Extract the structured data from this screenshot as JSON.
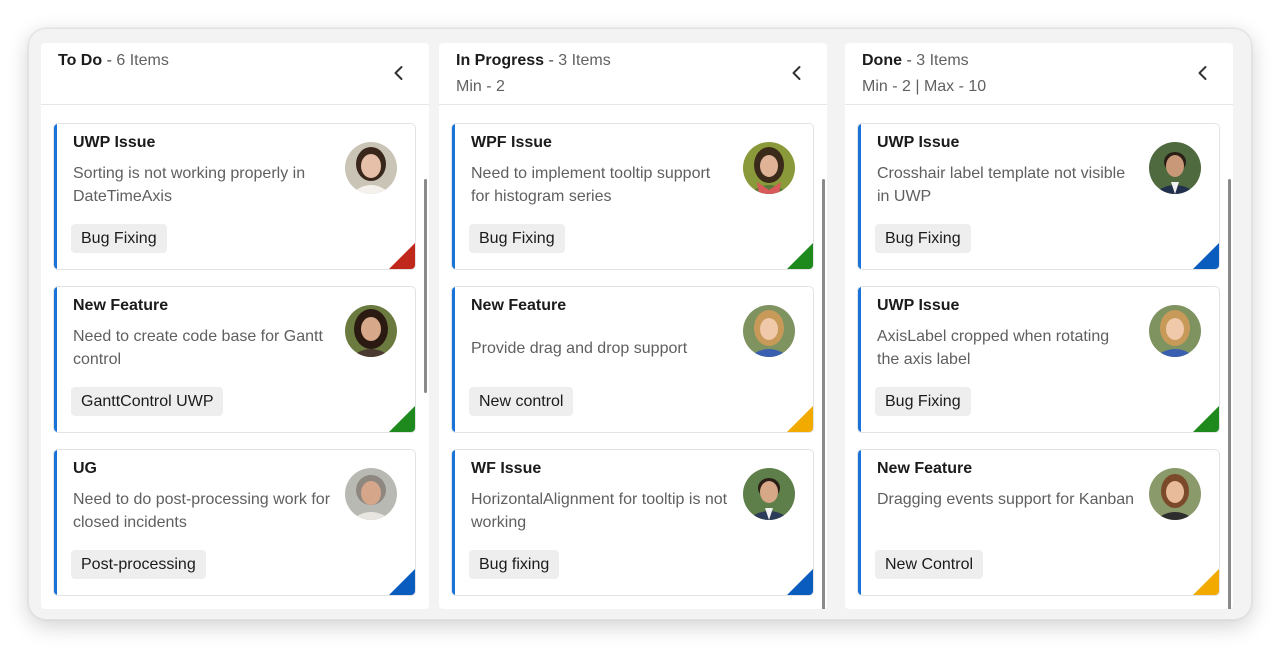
{
  "columns": [
    {
      "title": "To Do",
      "separator": " - ",
      "count": "6 Items",
      "limits": "",
      "collapse_icon": "chevron-left-icon",
      "cards": [
        {
          "title": "UWP Issue",
          "description": "Sorting is not working properly in DateTimeAxis",
          "tag": "Bug Fixing",
          "priority_color": "#c0281c",
          "avatar": "woman-brunette-avatar"
        },
        {
          "title": "New Feature",
          "description": "Need to create code base for Gantt control",
          "tag": "GanttControl UWP",
          "priority_color": "#1e8a1e",
          "avatar": "woman-dark-hair-avatar"
        },
        {
          "title": "UG",
          "description": "Need to do post-processing work for closed incidents",
          "tag": "Post-processing",
          "priority_color": "#0b5cbf",
          "avatar": "woman-gray-hair-avatar"
        }
      ]
    },
    {
      "title": "In Progress",
      "separator": " - ",
      "count": "3 Items",
      "limits": "Min - 2",
      "collapse_icon": "chevron-left-icon",
      "cards": [
        {
          "title": "WPF Issue",
          "description": "Need to implement tooltip support for histogram series",
          "tag": "Bug Fixing",
          "priority_color": "#1e8a1e",
          "avatar": "woman-scarf-avatar"
        },
        {
          "title": "New Feature",
          "description": "Provide drag and drop support",
          "tag": "New control",
          "priority_color": "#f2a900",
          "avatar": "woman-blonde-avatar"
        },
        {
          "title": "WF Issue",
          "description": "HorizontalAlignment for tooltip is not working",
          "tag": "Bug fixing",
          "priority_color": "#0b5cbf",
          "avatar": "man-suit-avatar"
        }
      ]
    },
    {
      "title": "Done",
      "separator": " - ",
      "count": "3 Items",
      "limits": "Min - 2 | Max - 10",
      "collapse_icon": "chevron-left-icon",
      "cards": [
        {
          "title": "UWP Issue",
          "description": "Crosshair label template not visible in UWP",
          "tag": "Bug Fixing",
          "priority_color": "#0b5cbf",
          "avatar": "man-suit-avatar"
        },
        {
          "title": "UWP Issue",
          "description": "AxisLabel cropped when rotating the axis label",
          "tag": "Bug Fixing",
          "priority_color": "#1e8a1e",
          "avatar": "woman-blonde-avatar"
        },
        {
          "title": "New Feature",
          "description": "Dragging events support for Kanban",
          "tag": "New Control",
          "priority_color": "#f2a900",
          "avatar": "woman-auburn-avatar"
        }
      ]
    }
  ],
  "card_accent_color": "#1a73d9"
}
